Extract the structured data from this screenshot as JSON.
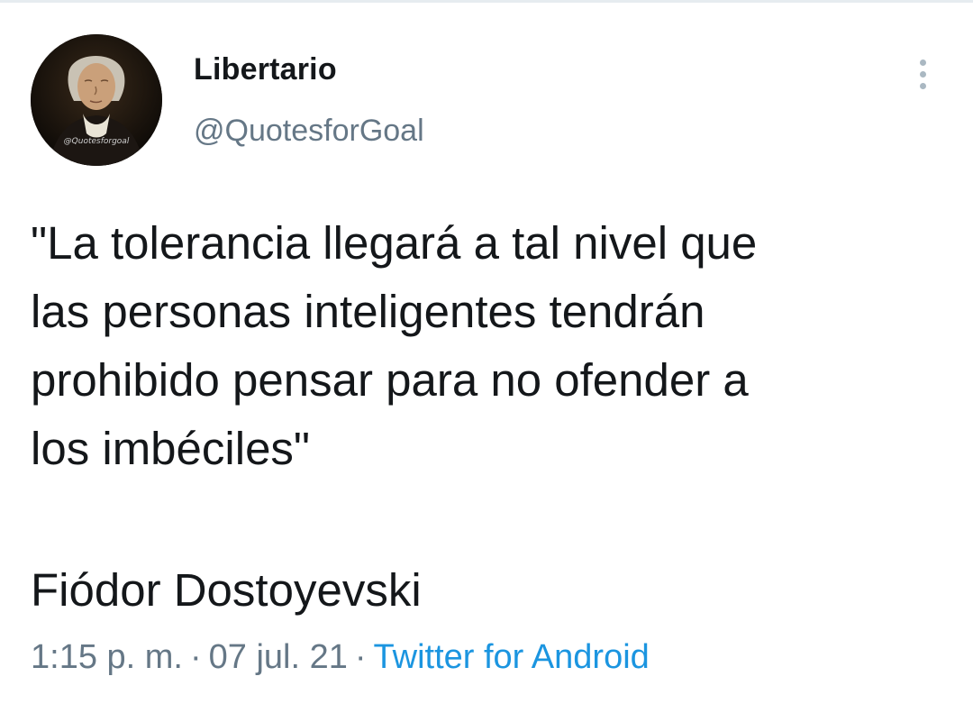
{
  "tweet": {
    "author": {
      "display_name": "Libertario",
      "handle": "@QuotesforGoal",
      "avatar_caption": "@Quotesforgoal"
    },
    "text_lines": [
      "\"La tolerancia llegará a tal nivel que",
      "las personas inteligentes tendrán",
      "prohibido pensar para no ofender a",
      "los imbéciles\""
    ],
    "attribution": "Fiódor Dostoyevski",
    "meta": {
      "time": "1:15 p. m.",
      "separator": "·",
      "date": "07 jul. 21",
      "source": "Twitter for Android"
    },
    "more_icon": "more-vertical-icon"
  },
  "colors": {
    "text": "#14171a",
    "secondary": "#657786",
    "link": "#1b95e0",
    "icon": "#aab8c2"
  }
}
